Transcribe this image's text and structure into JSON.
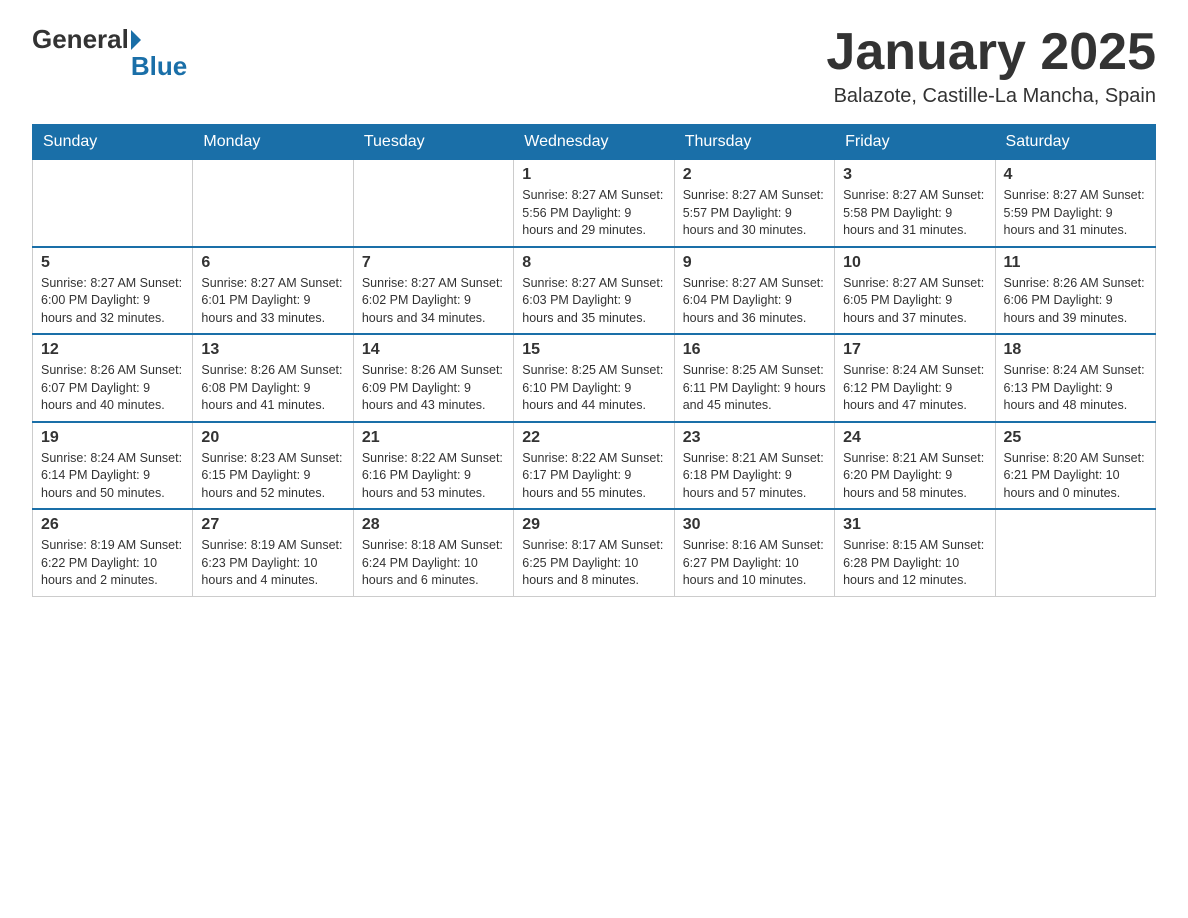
{
  "header": {
    "logo_general": "General",
    "logo_blue": "Blue",
    "month_title": "January 2025",
    "location": "Balazote, Castille-La Mancha, Spain"
  },
  "days_of_week": [
    "Sunday",
    "Monday",
    "Tuesday",
    "Wednesday",
    "Thursday",
    "Friday",
    "Saturday"
  ],
  "weeks": [
    [
      {
        "day": "",
        "info": ""
      },
      {
        "day": "",
        "info": ""
      },
      {
        "day": "",
        "info": ""
      },
      {
        "day": "1",
        "info": "Sunrise: 8:27 AM\nSunset: 5:56 PM\nDaylight: 9 hours\nand 29 minutes."
      },
      {
        "day": "2",
        "info": "Sunrise: 8:27 AM\nSunset: 5:57 PM\nDaylight: 9 hours\nand 30 minutes."
      },
      {
        "day": "3",
        "info": "Sunrise: 8:27 AM\nSunset: 5:58 PM\nDaylight: 9 hours\nand 31 minutes."
      },
      {
        "day": "4",
        "info": "Sunrise: 8:27 AM\nSunset: 5:59 PM\nDaylight: 9 hours\nand 31 minutes."
      }
    ],
    [
      {
        "day": "5",
        "info": "Sunrise: 8:27 AM\nSunset: 6:00 PM\nDaylight: 9 hours\nand 32 minutes."
      },
      {
        "day": "6",
        "info": "Sunrise: 8:27 AM\nSunset: 6:01 PM\nDaylight: 9 hours\nand 33 minutes."
      },
      {
        "day": "7",
        "info": "Sunrise: 8:27 AM\nSunset: 6:02 PM\nDaylight: 9 hours\nand 34 minutes."
      },
      {
        "day": "8",
        "info": "Sunrise: 8:27 AM\nSunset: 6:03 PM\nDaylight: 9 hours\nand 35 minutes."
      },
      {
        "day": "9",
        "info": "Sunrise: 8:27 AM\nSunset: 6:04 PM\nDaylight: 9 hours\nand 36 minutes."
      },
      {
        "day": "10",
        "info": "Sunrise: 8:27 AM\nSunset: 6:05 PM\nDaylight: 9 hours\nand 37 minutes."
      },
      {
        "day": "11",
        "info": "Sunrise: 8:26 AM\nSunset: 6:06 PM\nDaylight: 9 hours\nand 39 minutes."
      }
    ],
    [
      {
        "day": "12",
        "info": "Sunrise: 8:26 AM\nSunset: 6:07 PM\nDaylight: 9 hours\nand 40 minutes."
      },
      {
        "day": "13",
        "info": "Sunrise: 8:26 AM\nSunset: 6:08 PM\nDaylight: 9 hours\nand 41 minutes."
      },
      {
        "day": "14",
        "info": "Sunrise: 8:26 AM\nSunset: 6:09 PM\nDaylight: 9 hours\nand 43 minutes."
      },
      {
        "day": "15",
        "info": "Sunrise: 8:25 AM\nSunset: 6:10 PM\nDaylight: 9 hours\nand 44 minutes."
      },
      {
        "day": "16",
        "info": "Sunrise: 8:25 AM\nSunset: 6:11 PM\nDaylight: 9 hours\nand 45 minutes."
      },
      {
        "day": "17",
        "info": "Sunrise: 8:24 AM\nSunset: 6:12 PM\nDaylight: 9 hours\nand 47 minutes."
      },
      {
        "day": "18",
        "info": "Sunrise: 8:24 AM\nSunset: 6:13 PM\nDaylight: 9 hours\nand 48 minutes."
      }
    ],
    [
      {
        "day": "19",
        "info": "Sunrise: 8:24 AM\nSunset: 6:14 PM\nDaylight: 9 hours\nand 50 minutes."
      },
      {
        "day": "20",
        "info": "Sunrise: 8:23 AM\nSunset: 6:15 PM\nDaylight: 9 hours\nand 52 minutes."
      },
      {
        "day": "21",
        "info": "Sunrise: 8:22 AM\nSunset: 6:16 PM\nDaylight: 9 hours\nand 53 minutes."
      },
      {
        "day": "22",
        "info": "Sunrise: 8:22 AM\nSunset: 6:17 PM\nDaylight: 9 hours\nand 55 minutes."
      },
      {
        "day": "23",
        "info": "Sunrise: 8:21 AM\nSunset: 6:18 PM\nDaylight: 9 hours\nand 57 minutes."
      },
      {
        "day": "24",
        "info": "Sunrise: 8:21 AM\nSunset: 6:20 PM\nDaylight: 9 hours\nand 58 minutes."
      },
      {
        "day": "25",
        "info": "Sunrise: 8:20 AM\nSunset: 6:21 PM\nDaylight: 10 hours\nand 0 minutes."
      }
    ],
    [
      {
        "day": "26",
        "info": "Sunrise: 8:19 AM\nSunset: 6:22 PM\nDaylight: 10 hours\nand 2 minutes."
      },
      {
        "day": "27",
        "info": "Sunrise: 8:19 AM\nSunset: 6:23 PM\nDaylight: 10 hours\nand 4 minutes."
      },
      {
        "day": "28",
        "info": "Sunrise: 8:18 AM\nSunset: 6:24 PM\nDaylight: 10 hours\nand 6 minutes."
      },
      {
        "day": "29",
        "info": "Sunrise: 8:17 AM\nSunset: 6:25 PM\nDaylight: 10 hours\nand 8 minutes."
      },
      {
        "day": "30",
        "info": "Sunrise: 8:16 AM\nSunset: 6:27 PM\nDaylight: 10 hours\nand 10 minutes."
      },
      {
        "day": "31",
        "info": "Sunrise: 8:15 AM\nSunset: 6:28 PM\nDaylight: 10 hours\nand 12 minutes."
      },
      {
        "day": "",
        "info": ""
      }
    ]
  ]
}
